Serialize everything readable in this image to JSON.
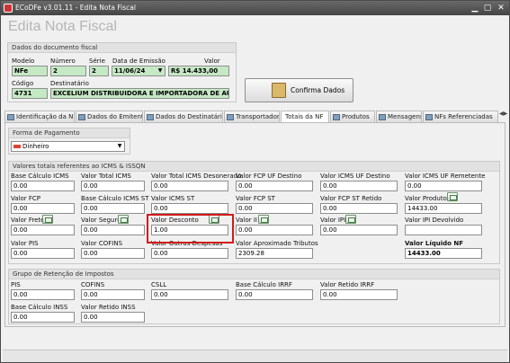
{
  "window": {
    "title": "ECoDFe v3.01.11 - Edita Nota Fiscal"
  },
  "heading": "Edita Nota Fiscal",
  "documento": {
    "group_title": "Dados do documento fiscal",
    "modelo_label": "Modelo",
    "modelo": "NFe",
    "numero_label": "Número",
    "numero": "2",
    "serie_label": "Série",
    "serie": "2",
    "data_label": "Data de Emissão",
    "data": "11/06/24",
    "valor_label": "Valor",
    "valor": "R$ 14.433,00",
    "codigo_label": "Código",
    "codigo": "4731",
    "destinatario_label": "Destinatário",
    "destinatario": "EXCELIUM DISTRIBUIDORA E IMPORTADORA DE AUTO PE("
  },
  "confirm_button": "Confirma Dados",
  "tabs": [
    "Identificação da NF",
    "Dados do Emitente",
    "Dados do Destinatário",
    "Transportador",
    "Totais da NF",
    "Produtos",
    "Mensagens",
    "NFs Referenciadas"
  ],
  "pagamento": {
    "group_title": "Forma de Pagamento",
    "value": "Dinheiro"
  },
  "totais": {
    "group_title": "Valores totais referentes ao ICMS & ISSQN",
    "fields": [
      {
        "label": "Base Cálculo ICMS",
        "value": "0.00"
      },
      {
        "label": "Valor Total ICMS",
        "value": "0.00"
      },
      {
        "label": "Valor Total ICMS Desonerado",
        "value": "0.00"
      },
      {
        "label": "Valor FCP UF Destino",
        "value": "0.00"
      },
      {
        "label": "Valor ICMS UF Destino",
        "value": "0.00"
      },
      {
        "label": "Valor ICMS UF Remetente",
        "value": "0.00"
      },
      {
        "label": "Valor FCP",
        "value": "0.00"
      },
      {
        "label": "Base Cálculo ICMS ST",
        "value": "0.00"
      },
      {
        "label": "Valor ICMS ST",
        "value": "0.00"
      },
      {
        "label": "Valor FCP ST",
        "value": "0.00"
      },
      {
        "label": "Valor FCP ST Retido",
        "value": "0.00"
      },
      {
        "label": "Valor Produtos",
        "value": "14433.00"
      },
      {
        "label": "Valor Frete",
        "value": "0.00"
      },
      {
        "label": "Valor Seguro",
        "value": "0.00"
      },
      {
        "label": "Valor Desconto",
        "value": "1.00"
      },
      {
        "label": "Valor II",
        "value": "0.00"
      },
      {
        "label": "Valor IPI",
        "value": "0.00"
      },
      {
        "label": "Valor IPI Devolvido",
        "value": ""
      },
      {
        "label": "Valor PIS",
        "value": "0.00"
      },
      {
        "label": "Valor COFINS",
        "value": "0.00"
      },
      {
        "label": "Valor Outras Despesas",
        "value": "0.00"
      },
      {
        "label": "Valor Aproximado Tributos",
        "value": "2309.28"
      },
      {
        "label": "",
        "value": ""
      },
      {
        "label": "Valor Líquido NF",
        "value": "14433.00"
      }
    ]
  },
  "retencao": {
    "group_title": "Grupo de Retenção de Impostos",
    "fields": [
      {
        "label": "PIS",
        "value": "0.00"
      },
      {
        "label": "COFINS",
        "value": "0.00"
      },
      {
        "label": "CSLL",
        "value": "0.00"
      },
      {
        "label": "Base Cálculo IRRF",
        "value": "0.00"
      },
      {
        "label": "Valor Retido IRRF",
        "value": "0.00"
      },
      {
        "label": "Base Cálculo INSS",
        "value": "0.00"
      },
      {
        "label": "Valor Retido INSS",
        "value": "0.00"
      }
    ]
  },
  "colors": {
    "highlight_border": "#d21a1a",
    "readonly_field": "#c5e8c5"
  }
}
